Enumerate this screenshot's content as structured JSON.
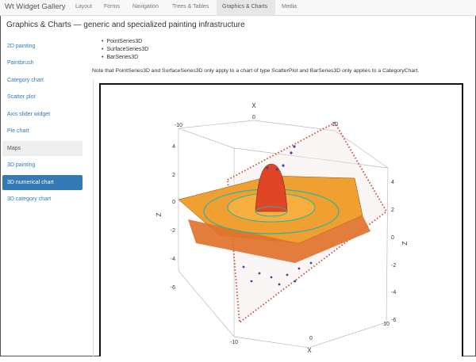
{
  "app": {
    "brand": "Wt Widget Gallery"
  },
  "nav": [
    "Layout",
    "Forms",
    "Navigation",
    "Trees & Tables",
    "Graphics & Charts",
    "Media"
  ],
  "page": {
    "title": "Graphics & Charts — generic and specialized painting infrastructure"
  },
  "sidebar": [
    "2D painting",
    "Paintbrush",
    "Category chart",
    "Scatter plot",
    "Axis slider widget",
    "Pie chart",
    "Maps",
    "3D painting",
    "3D numerical chart",
    "3D category chart"
  ],
  "content": {
    "bullets": [
      "PointSeries3D",
      "SurfaceSeries3D",
      "BarSeries3D"
    ],
    "note": "Note that PointSeries3D and SurfaceSeries3D only apply to a chart of type ScatterPlot and BarSeries3D only applies to a CategoryChart."
  },
  "chart": {
    "x_label": "X",
    "z_label": "Z",
    "ticks": {
      "top_x": [
        "-10",
        "0",
        "10"
      ],
      "left_z": [
        "4",
        "2",
        "0",
        "-2",
        "-4",
        "-6"
      ],
      "right_z": [
        "4",
        "2",
        "0",
        "-2",
        "-4",
        "-6"
      ],
      "bottom_x": [
        "-10",
        "0",
        "10"
      ]
    }
  }
}
